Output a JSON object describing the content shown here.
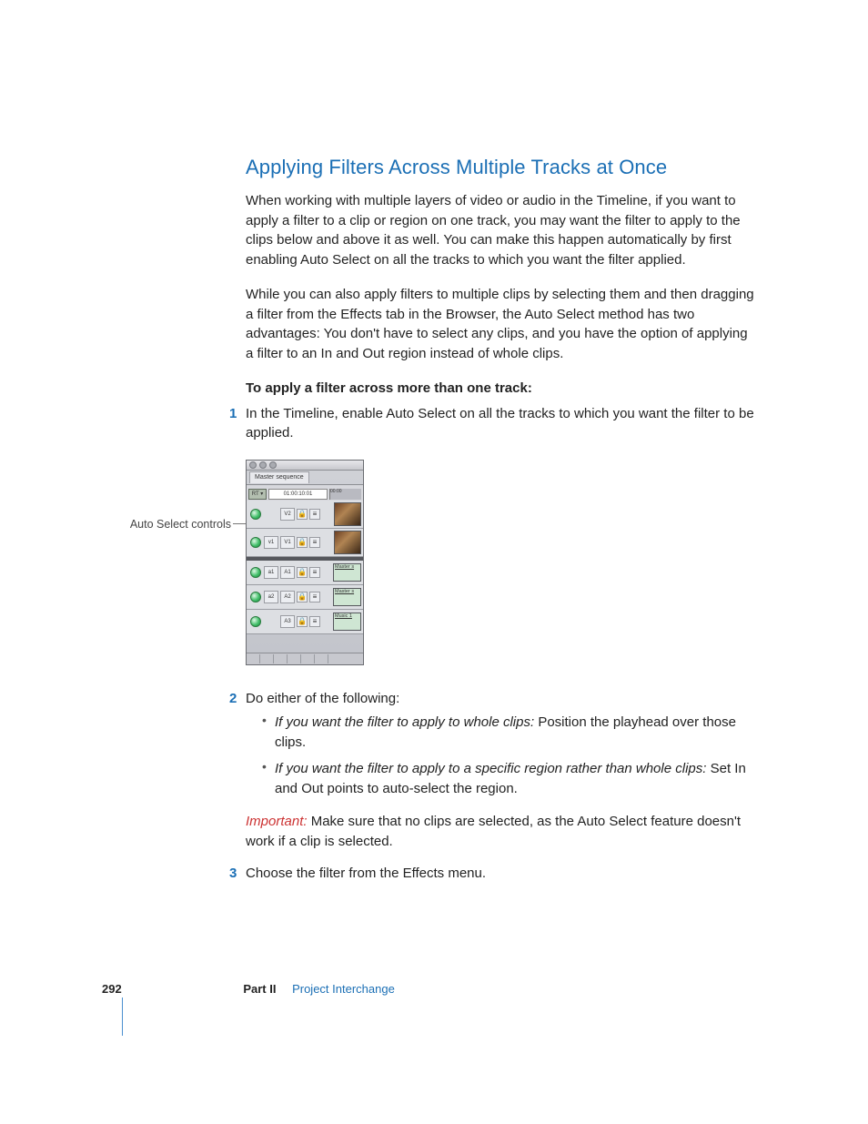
{
  "heading": "Applying Filters Across Multiple Tracks at Once",
  "para1": "When working with multiple layers of video or audio in the Timeline, if you want to apply a filter to a clip or region on one track, you may want the filter to apply to the clips below and above it as well. You can make this happen automatically by first enabling Auto Select on all the tracks to which you want the filter applied.",
  "para2": "While you can also apply filters to multiple clips by selecting them and then dragging a filter from the Effects tab in the Browser, the Auto Select method has two advantages:  You don't have to select any clips, and you have the option of applying a filter to an In and Out region instead of whole clips.",
  "procedure_title": "To apply a filter across more than one track:",
  "step1": "In the Timeline, enable Auto Select on all the tracks to which you want the filter to be applied.",
  "callout": "Auto Select controls",
  "timeline": {
    "tab": "Master sequence",
    "rt": "RT ▾",
    "timecode": "01:00:10:01",
    "ruler": "00:00",
    "tracks": {
      "v2": "V2",
      "v1_src": "v1",
      "v1": "V1",
      "a1_src": "a1",
      "a1": "A1",
      "a2_src": "a2",
      "a2": "A2",
      "a3": "A3"
    },
    "clips": {
      "master_s": "Master s",
      "music": "Music 1"
    }
  },
  "step2_intro": "Do either of the following:",
  "bullet1_lead": "If you want the filter to apply to whole clips: ",
  "bullet1_rest": " Position the playhead over those clips.",
  "bullet2_lead": "If you want the filter to apply to a specific region rather than whole clips: ",
  "bullet2_rest": " Set In and Out points to auto-select the region.",
  "important_label": "Important:  ",
  "important_text": "Make sure that no clips are selected, as the Auto Select feature doesn't work if a clip is selected.",
  "step3": "Choose the filter from the Effects menu.",
  "footer": {
    "page": "292",
    "part": "Part II",
    "chapter": "Project Interchange"
  }
}
